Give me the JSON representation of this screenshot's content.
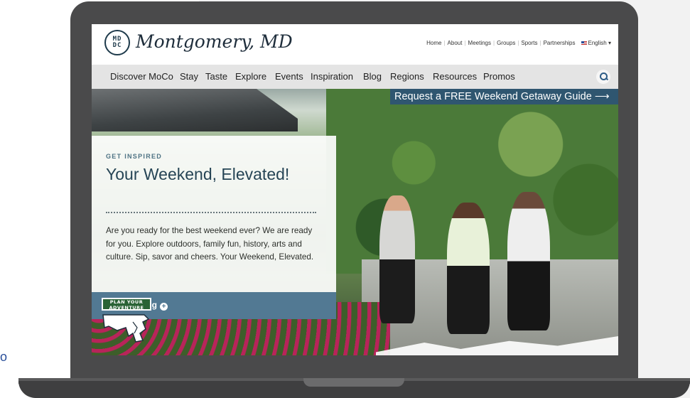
{
  "edge_text": "o",
  "site": {
    "logo_monogram": "MD DC",
    "logo_text": "Montgomery, MD"
  },
  "toplinks": [
    "Home",
    "About",
    "Meetings",
    "Groups",
    "Sports",
    "Partnerships"
  ],
  "language": "English ▾",
  "nav": [
    "Discover MoCo",
    "Stay",
    "Taste",
    "Explore",
    "Events",
    "Inspiration",
    "Blog",
    "Regions",
    "Resources",
    "Promos"
  ],
  "request_banner": "Request a FREE Weekend Getaway Guide ⟶",
  "hero": {
    "eyebrow": "GET INSPIRED",
    "headline": "Your Weekend, Elevated!",
    "body": "Are you ready for the best weekend ever? We are ready for you. Explore outdoors, family fun, history, arts and culture. Sip, savor and cheers. Your Weekend, Elevated.",
    "cta": "ing",
    "cta_icon": "plus-circle-icon",
    "badge": "PLAN YOUR ADVENTURE"
  },
  "colors": {
    "nav_bg": "#e4e4e4",
    "banner_bg": "#2f5670",
    "cta_bg": "#527993",
    "headline": "#1f3d54",
    "laptop": "#4a4a4b"
  }
}
